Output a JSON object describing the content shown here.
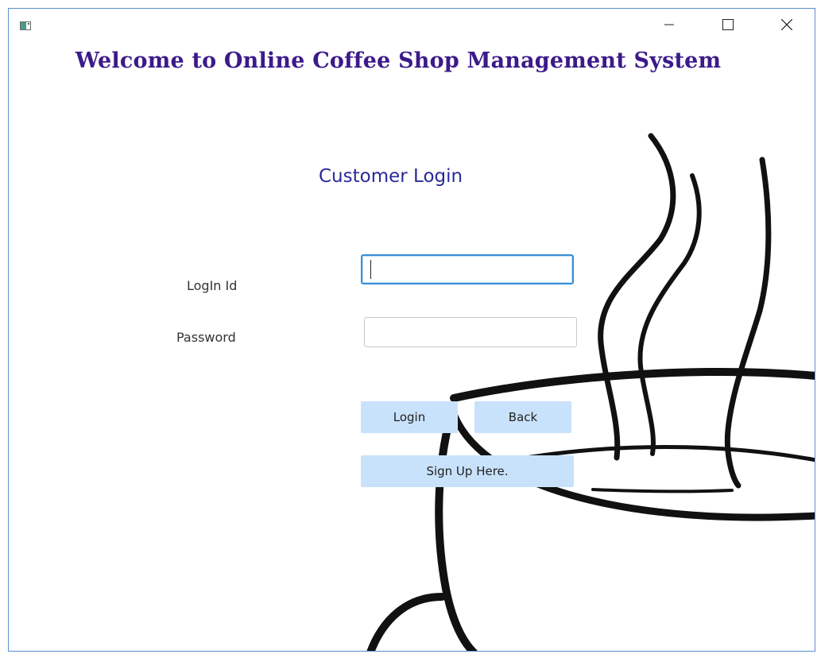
{
  "window": {
    "icons": {
      "app": "app-icon",
      "minimize": "minimize-icon",
      "maximize": "maximize-icon",
      "close": "close-icon"
    }
  },
  "header": {
    "welcome": "Welcome to Online Coffee Shop Management System"
  },
  "form": {
    "title": "Customer Login",
    "login_label": "LogIn Id",
    "password_label": "Password",
    "login_value": "",
    "password_value": ""
  },
  "buttons": {
    "login": "Login",
    "back": "Back",
    "signup": "Sign Up Here."
  },
  "colors": {
    "title": "#3c1a8a",
    "form_title": "#2a2a9a",
    "button_bg": "#c9e2fb",
    "focus_border": "#3a8fd6",
    "window_border": "#5a8ed0"
  }
}
